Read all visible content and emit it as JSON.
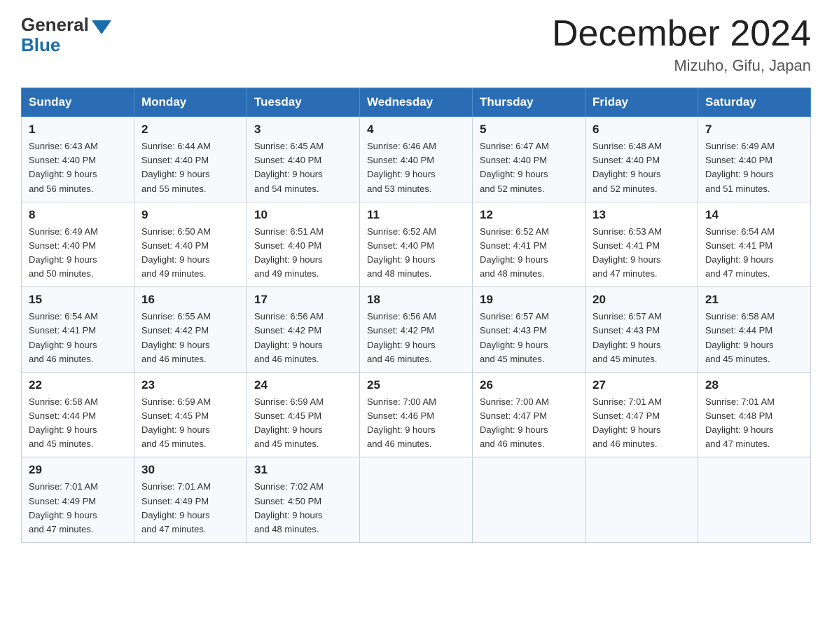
{
  "header": {
    "logo_general": "General",
    "logo_blue": "Blue",
    "month_title": "December 2024",
    "location": "Mizuho, Gifu, Japan"
  },
  "days_of_week": [
    "Sunday",
    "Monday",
    "Tuesday",
    "Wednesday",
    "Thursday",
    "Friday",
    "Saturday"
  ],
  "weeks": [
    [
      {
        "day": "1",
        "sunrise": "6:43 AM",
        "sunset": "4:40 PM",
        "daylight": "9 hours and 56 minutes."
      },
      {
        "day": "2",
        "sunrise": "6:44 AM",
        "sunset": "4:40 PM",
        "daylight": "9 hours and 55 minutes."
      },
      {
        "day": "3",
        "sunrise": "6:45 AM",
        "sunset": "4:40 PM",
        "daylight": "9 hours and 54 minutes."
      },
      {
        "day": "4",
        "sunrise": "6:46 AM",
        "sunset": "4:40 PM",
        "daylight": "9 hours and 53 minutes."
      },
      {
        "day": "5",
        "sunrise": "6:47 AM",
        "sunset": "4:40 PM",
        "daylight": "9 hours and 52 minutes."
      },
      {
        "day": "6",
        "sunrise": "6:48 AM",
        "sunset": "4:40 PM",
        "daylight": "9 hours and 52 minutes."
      },
      {
        "day": "7",
        "sunrise": "6:49 AM",
        "sunset": "4:40 PM",
        "daylight": "9 hours and 51 minutes."
      }
    ],
    [
      {
        "day": "8",
        "sunrise": "6:49 AM",
        "sunset": "4:40 PM",
        "daylight": "9 hours and 50 minutes."
      },
      {
        "day": "9",
        "sunrise": "6:50 AM",
        "sunset": "4:40 PM",
        "daylight": "9 hours and 49 minutes."
      },
      {
        "day": "10",
        "sunrise": "6:51 AM",
        "sunset": "4:40 PM",
        "daylight": "9 hours and 49 minutes."
      },
      {
        "day": "11",
        "sunrise": "6:52 AM",
        "sunset": "4:40 PM",
        "daylight": "9 hours and 48 minutes."
      },
      {
        "day": "12",
        "sunrise": "6:52 AM",
        "sunset": "4:41 PM",
        "daylight": "9 hours and 48 minutes."
      },
      {
        "day": "13",
        "sunrise": "6:53 AM",
        "sunset": "4:41 PM",
        "daylight": "9 hours and 47 minutes."
      },
      {
        "day": "14",
        "sunrise": "6:54 AM",
        "sunset": "4:41 PM",
        "daylight": "9 hours and 47 minutes."
      }
    ],
    [
      {
        "day": "15",
        "sunrise": "6:54 AM",
        "sunset": "4:41 PM",
        "daylight": "9 hours and 46 minutes."
      },
      {
        "day": "16",
        "sunrise": "6:55 AM",
        "sunset": "4:42 PM",
        "daylight": "9 hours and 46 minutes."
      },
      {
        "day": "17",
        "sunrise": "6:56 AM",
        "sunset": "4:42 PM",
        "daylight": "9 hours and 46 minutes."
      },
      {
        "day": "18",
        "sunrise": "6:56 AM",
        "sunset": "4:42 PM",
        "daylight": "9 hours and 46 minutes."
      },
      {
        "day": "19",
        "sunrise": "6:57 AM",
        "sunset": "4:43 PM",
        "daylight": "9 hours and 45 minutes."
      },
      {
        "day": "20",
        "sunrise": "6:57 AM",
        "sunset": "4:43 PM",
        "daylight": "9 hours and 45 minutes."
      },
      {
        "day": "21",
        "sunrise": "6:58 AM",
        "sunset": "4:44 PM",
        "daylight": "9 hours and 45 minutes."
      }
    ],
    [
      {
        "day": "22",
        "sunrise": "6:58 AM",
        "sunset": "4:44 PM",
        "daylight": "9 hours and 45 minutes."
      },
      {
        "day": "23",
        "sunrise": "6:59 AM",
        "sunset": "4:45 PM",
        "daylight": "9 hours and 45 minutes."
      },
      {
        "day": "24",
        "sunrise": "6:59 AM",
        "sunset": "4:45 PM",
        "daylight": "9 hours and 45 minutes."
      },
      {
        "day": "25",
        "sunrise": "7:00 AM",
        "sunset": "4:46 PM",
        "daylight": "9 hours and 46 minutes."
      },
      {
        "day": "26",
        "sunrise": "7:00 AM",
        "sunset": "4:47 PM",
        "daylight": "9 hours and 46 minutes."
      },
      {
        "day": "27",
        "sunrise": "7:01 AM",
        "sunset": "4:47 PM",
        "daylight": "9 hours and 46 minutes."
      },
      {
        "day": "28",
        "sunrise": "7:01 AM",
        "sunset": "4:48 PM",
        "daylight": "9 hours and 47 minutes."
      }
    ],
    [
      {
        "day": "29",
        "sunrise": "7:01 AM",
        "sunset": "4:49 PM",
        "daylight": "9 hours and 47 minutes."
      },
      {
        "day": "30",
        "sunrise": "7:01 AM",
        "sunset": "4:49 PM",
        "daylight": "9 hours and 47 minutes."
      },
      {
        "day": "31",
        "sunrise": "7:02 AM",
        "sunset": "4:50 PM",
        "daylight": "9 hours and 48 minutes."
      },
      null,
      null,
      null,
      null
    ]
  ],
  "labels": {
    "sunrise": "Sunrise:",
    "sunset": "Sunset:",
    "daylight": "Daylight:"
  }
}
